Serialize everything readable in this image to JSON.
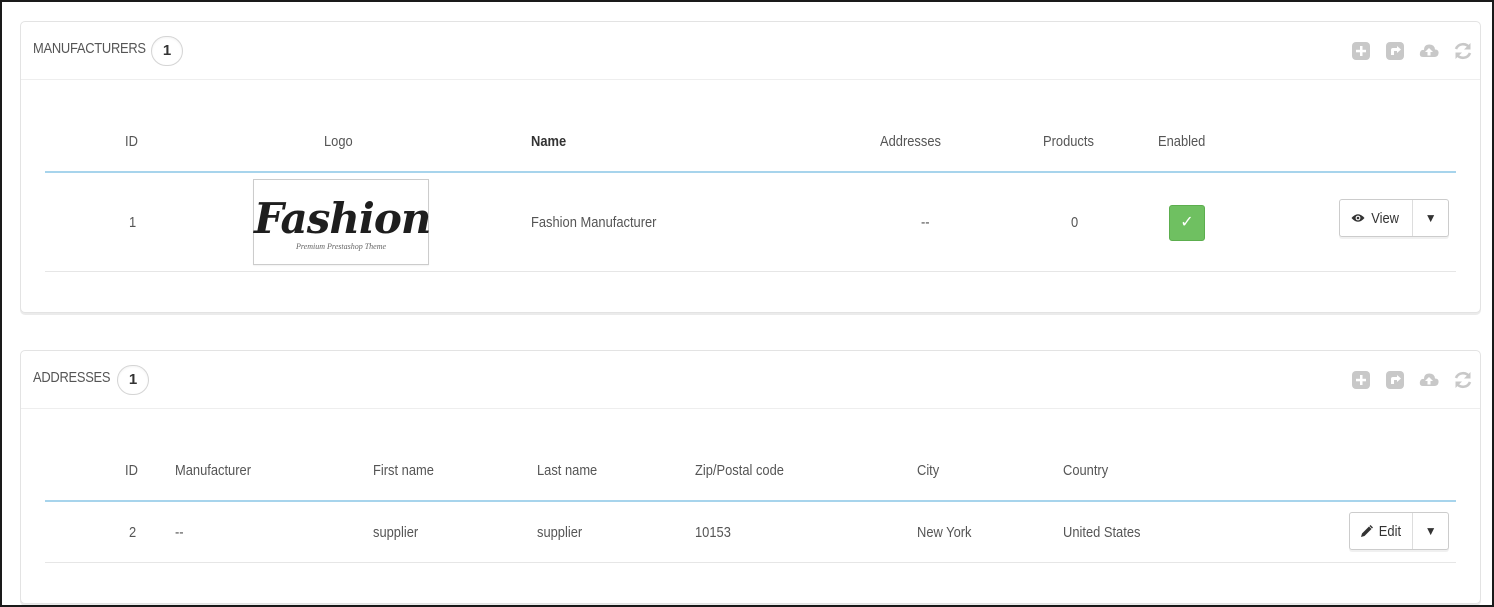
{
  "manufacturers": {
    "title": "MANUFACTURERS",
    "count": "1",
    "toolbar_icons": [
      "add-icon",
      "export-icon",
      "import-icon",
      "refresh-icon"
    ],
    "columns": {
      "id": "ID",
      "logo": "Logo",
      "name": "Name",
      "addresses": "Addresses",
      "products": "Products",
      "enabled": "Enabled"
    },
    "row": {
      "id": "1",
      "logo_text": "Fashion",
      "logo_subtext": "Premium Prestashop Theme",
      "name": "Fashion Manufacturer",
      "addresses": "--",
      "products": "0",
      "enabled": true,
      "enabled_icon": "✓",
      "action_label": "View",
      "action_icon": "eye-icon"
    }
  },
  "addresses": {
    "title": "ADDRESSES",
    "count": "1",
    "toolbar_icons": [
      "add-icon",
      "export-icon",
      "import-icon",
      "refresh-icon"
    ],
    "columns": {
      "id": "ID",
      "manufacturer": "Manufacturer",
      "first_name": "First name",
      "last_name": "Last name",
      "zip": "Zip/Postal code",
      "city": "City",
      "country": "Country"
    },
    "row": {
      "id": "2",
      "manufacturer": "--",
      "first_name": "supplier",
      "last_name": "supplier",
      "zip": "10153",
      "city": "New York",
      "country": "United States",
      "action_label": "Edit",
      "action_icon": "pencil-icon"
    }
  },
  "colors": {
    "enabled_green": "#6fc061",
    "header_rule": "#a7d4ec",
    "icon_grey": "#c8c8c8"
  }
}
